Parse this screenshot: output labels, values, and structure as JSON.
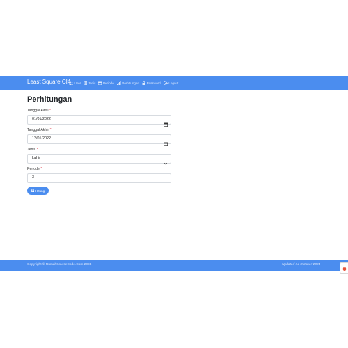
{
  "navbar": {
    "brand": "Least Square CI4",
    "items": [
      {
        "label": "User",
        "icon": "users-icon"
      },
      {
        "label": "Jenis",
        "icon": "table-icon"
      },
      {
        "label": "Periode",
        "icon": "calendar-icon"
      },
      {
        "label": "Perhitungan",
        "icon": "chart-icon"
      },
      {
        "label": "Password",
        "icon": "lock-icon"
      },
      {
        "label": "Logout",
        "icon": "logout-icon"
      }
    ]
  },
  "page": {
    "title": "Perhitungan"
  },
  "form": {
    "tanggal_awal": {
      "label": "Tanggal Awal",
      "required": "*",
      "value": "01/01/2022"
    },
    "tanggal_akhir": {
      "label": "Tanggal Akhir",
      "required": "*",
      "value": "12/01/2022"
    },
    "jenis": {
      "label": "Jenis",
      "required": "*",
      "value": "Lahir"
    },
    "periode": {
      "label": "Periode",
      "required": "*",
      "value": "3"
    },
    "submit_label": "Hitung"
  },
  "footer": {
    "copyright": "Copyright © RumahSourceCode.Com 2024",
    "updated": "Updated 14 Oktober 2024"
  },
  "colors": {
    "accent": "#4b8def",
    "required": "#dc3545"
  }
}
